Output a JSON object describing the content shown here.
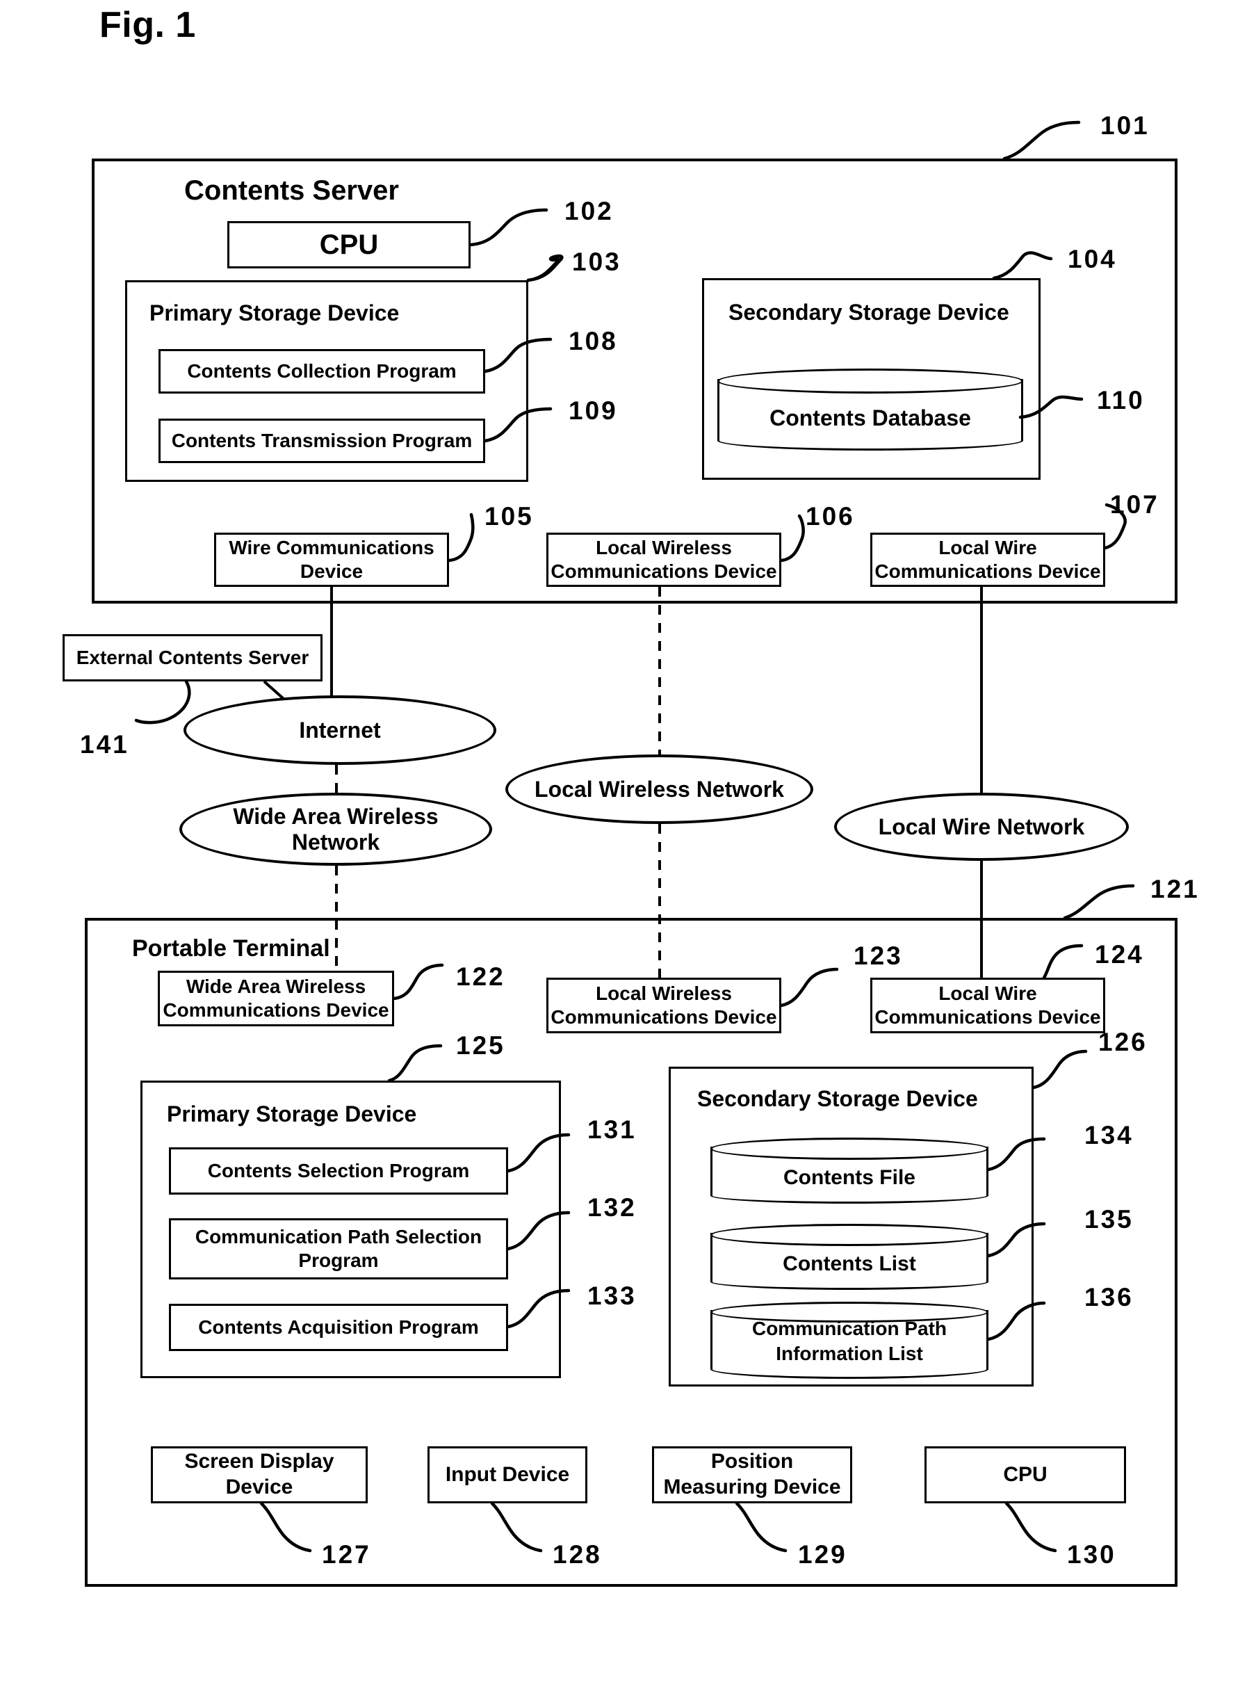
{
  "figure": {
    "title": "Fig. 1"
  },
  "contents_server": {
    "label": "Contents Server",
    "ref": "101",
    "cpu": {
      "label": "CPU",
      "ref": "102"
    },
    "primary_storage": {
      "label": "Primary Storage Device",
      "ref": "103",
      "programs": [
        {
          "label": "Contents Collection Program",
          "ref": "108"
        },
        {
          "label": "Contents Transmission Program",
          "ref": "109"
        }
      ]
    },
    "secondary_storage": {
      "label": "Secondary Storage Device",
      "ref": "104",
      "stores": [
        {
          "label": "Contents Database",
          "ref": "110"
        }
      ]
    },
    "comm_devices": [
      {
        "label": "Wire Communications Device",
        "line1": "Wire Communications",
        "line2": "Device",
        "ref": "105"
      },
      {
        "label": "Local Wireless Communications Device",
        "line1": "Local Wireless",
        "line2": "Communications Device",
        "ref": "106"
      },
      {
        "label": "Local Wire Communications Device",
        "line1": "Local Wire",
        "line2": "Communications Device",
        "ref": "107"
      }
    ]
  },
  "external": {
    "server": {
      "label": "External Contents Server",
      "ref": "141"
    }
  },
  "networks": [
    {
      "label": "Internet",
      "name": "internet"
    },
    {
      "label": "Wide Area Wireless Network",
      "line1": "Wide Area Wireless",
      "line2": "Network",
      "name": "wide-area-wireless-network"
    },
    {
      "label": "Local Wireless Network",
      "name": "local-wireless-network"
    },
    {
      "label": "Local Wire Network",
      "name": "local-wire-network"
    }
  ],
  "portable_terminal": {
    "label": "Portable Terminal",
    "ref": "121",
    "comm_devices": [
      {
        "label": "Wide Area Wireless Communications Device",
        "line1": "Wide Area Wireless",
        "line2": "Communications Device",
        "ref": "122"
      },
      {
        "label": "Local Wireless Communications Device",
        "line1": "Local Wireless",
        "line2": "Communications Device",
        "ref": "123"
      },
      {
        "label": "Local Wire Communications Device",
        "line1": "Local Wire",
        "line2": "Communications Device",
        "ref": "124"
      }
    ],
    "primary_storage": {
      "label": "Primary Storage Device",
      "ref": "125",
      "programs": [
        {
          "label": "Contents Selection Program",
          "line1": "Contents Selection Program",
          "line2": "",
          "ref": "131"
        },
        {
          "label": "Communication Path Selection Program",
          "line1": "Communication Path Selection",
          "line2": "Program",
          "ref": "132"
        },
        {
          "label": "Contents Acquisition Program",
          "line1": "Contents Acquisition Program",
          "line2": "",
          "ref": "133"
        }
      ]
    },
    "secondary_storage": {
      "label": "Secondary Storage Device",
      "ref": "126",
      "stores": [
        {
          "label": "Contents File",
          "line1": "Contents File",
          "line2": "",
          "ref": "134"
        },
        {
          "label": "Contents List",
          "line1": "Contents List",
          "line2": "",
          "ref": "135"
        },
        {
          "label": "Communication Path Information List",
          "line1": "Communication Path",
          "line2": "Information List",
          "ref": "136"
        }
      ]
    },
    "peripherals": [
      {
        "label": "Screen Display Device",
        "line1": "Screen Display",
        "line2": "Device",
        "ref": "127"
      },
      {
        "label": "Input Device",
        "line1": "Input Device",
        "line2": "",
        "ref": "128"
      },
      {
        "label": "Position Measuring Device",
        "line1": "Position",
        "line2": "Measuring Device",
        "ref": "129"
      },
      {
        "label": "CPU",
        "line1": "CPU",
        "line2": "",
        "ref": "130"
      }
    ]
  }
}
